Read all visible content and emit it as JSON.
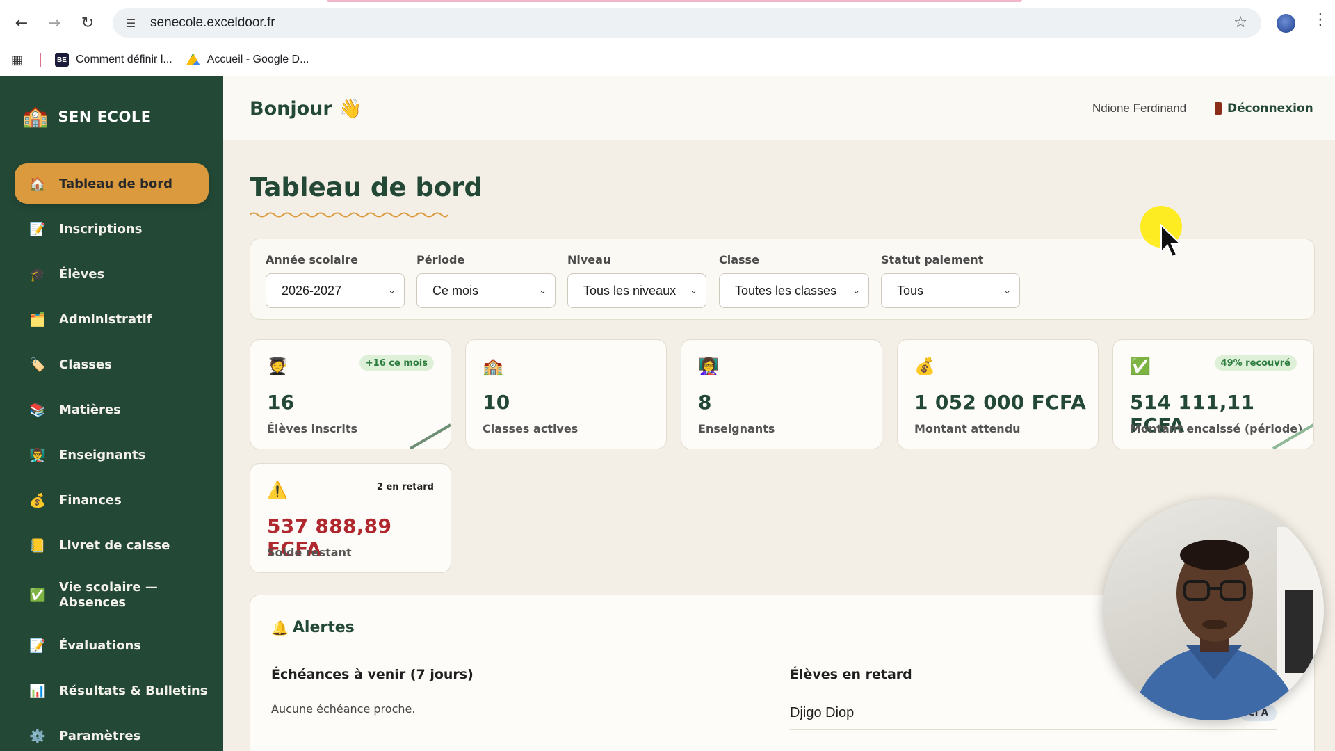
{
  "browser": {
    "url": "senecole.exceldoor.fr",
    "bookmarks": [
      {
        "label": "Comment définir l...",
        "fav": "BE"
      },
      {
        "label": "Accueil - Google D..."
      }
    ]
  },
  "sidebar": {
    "brand": "SEN ECOLE",
    "items": [
      {
        "label": "Tableau de bord",
        "icon": "🏠"
      },
      {
        "label": "Inscriptions",
        "icon": "📝"
      },
      {
        "label": "Élèves",
        "icon": "🎓"
      },
      {
        "label": "Administratif",
        "icon": "🗂️"
      },
      {
        "label": "Classes",
        "icon": "🏷️"
      },
      {
        "label": "Matières",
        "icon": "📚"
      },
      {
        "label": "Enseignants",
        "icon": "👨‍🏫"
      },
      {
        "label": "Finances",
        "icon": "💰"
      },
      {
        "label": "Livret de caisse",
        "icon": "📒"
      },
      {
        "label": "Vie scolaire — Absences",
        "icon": "✅"
      },
      {
        "label": "Évaluations",
        "icon": "📝"
      },
      {
        "label": "Résultats & Bulletins",
        "icon": "📊"
      },
      {
        "label": "Paramètres",
        "icon": "⚙️"
      }
    ]
  },
  "header": {
    "greeting": "Bonjour 👋",
    "user": "Ndione Ferdinand",
    "logout": "Déconnexion"
  },
  "main": {
    "title": "Tableau de bord",
    "filters": [
      {
        "label": "Année scolaire",
        "value": "2026-2027"
      },
      {
        "label": "Période",
        "value": "Ce mois"
      },
      {
        "label": "Niveau",
        "value": "Tous les niveaux"
      },
      {
        "label": "Classe",
        "value": "Toutes les classes"
      },
      {
        "label": "Statut paiement",
        "value": "Tous"
      }
    ],
    "cards": [
      {
        "icon": "🧑‍🎓",
        "badge": "+16 ce mois",
        "value": "16",
        "label": "Élèves inscrits"
      },
      {
        "icon": "🏫",
        "badge": "",
        "value": "10",
        "label": "Classes actives"
      },
      {
        "icon": "👩‍🏫",
        "badge": "",
        "value": "8",
        "label": "Enseignants"
      },
      {
        "icon": "💰",
        "badge": "",
        "value": "1 052 000 FCFA",
        "label": "Montant attendu"
      },
      {
        "icon": "✅",
        "badge": "49% recouvré",
        "value": "514 111,11 FCFA",
        "label": "Montant encaissé (période)"
      },
      {
        "icon": "⚠️",
        "badge": "2 en retard",
        "value": "537 888,89 FCFA",
        "label": "Solde restant"
      }
    ]
  },
  "alerts": {
    "title": "Alertes",
    "upcoming": {
      "title": "Échéances à venir (7 jours)",
      "empty": "Aucune échéance proche."
    },
    "late": {
      "title": "Élèves en retard",
      "rows": [
        {
          "name": "Djigo Diop",
          "class": "CI A"
        }
      ]
    }
  }
}
